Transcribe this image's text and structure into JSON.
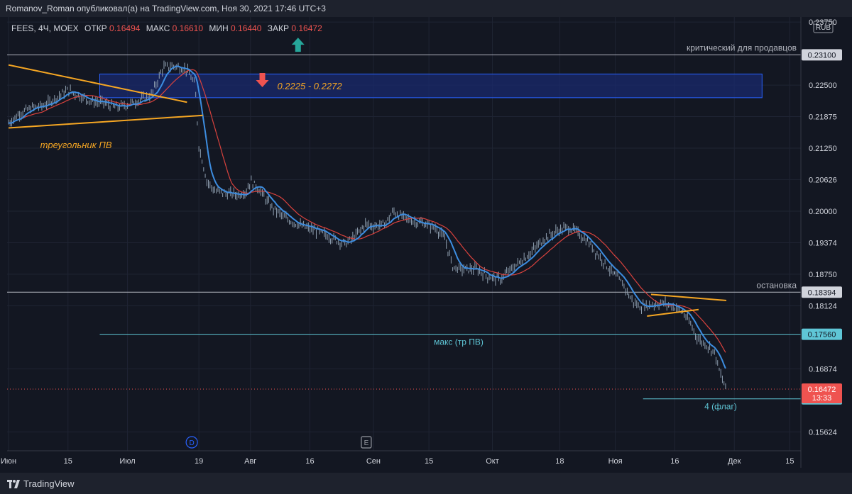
{
  "header": {
    "text": "Romanov_Roman опубликовал(а) на TradingView.com, Ноя 30, 2021 17:46 UTC+3"
  },
  "footer": {
    "brand": "TradingView"
  },
  "colors": {
    "background": "#131722",
    "panel": "#1e222d",
    "grid": "#1f2433",
    "candles": "#8f9fb0",
    "ma_fast": "#3d8de0",
    "ma_slow": "#d9423d",
    "triangle": "#f5a623",
    "zone": "#1a2a6e",
    "zone_border": "#2962ff",
    "resistance_line": "#b2b5be",
    "cyan_line": "#5fc6d6",
    "last_price": "#ef5350",
    "arrow_up": "#26a69a",
    "arrow_down": "#ef5350"
  },
  "chart_data": {
    "type": "candlestick",
    "symbol_line": {
      "symbol": "FEES, 4Ч, MOEX",
      "open_label": "ОТКР",
      "open": "0.16494",
      "high_label": "МАКС",
      "high": "0.16610",
      "low_label": "МИН",
      "low": "0.16440",
      "close_label": "ЗАКР",
      "close": "0.16472"
    },
    "currency": "RUB",
    "ylim": [
      0.1525,
      0.2385
    ],
    "x_days_range": [
      0,
      198
    ],
    "y_ticks": [
      "0.23750",
      "0.22500",
      "0.21875",
      "0.21250",
      "0.20626",
      "0.20000",
      "0.19374",
      "0.18750",
      "0.18124",
      "0.16874",
      "0.15624"
    ],
    "x_ticks": [
      {
        "label": "Июн",
        "day": 0
      },
      {
        "label": "15",
        "day": 15
      },
      {
        "label": "Июл",
        "day": 30
      },
      {
        "label": "19",
        "day": 48
      },
      {
        "label": "Авг",
        "day": 61
      },
      {
        "label": "16",
        "day": 76
      },
      {
        "label": "Сен",
        "day": 92
      },
      {
        "label": "15",
        "day": 106
      },
      {
        "label": "Окт",
        "day": 122
      },
      {
        "label": "18",
        "day": 139
      },
      {
        "label": "Ноя",
        "day": 153
      },
      {
        "label": "16",
        "day": 168
      },
      {
        "label": "Дек",
        "day": 183
      },
      {
        "label": "15",
        "day": 197
      }
    ],
    "price_path": [
      [
        0,
        0.2175
      ],
      [
        3,
        0.2195
      ],
      [
        6,
        0.2205
      ],
      [
        9,
        0.221
      ],
      [
        12,
        0.2225
      ],
      [
        15,
        0.224
      ],
      [
        18,
        0.2228
      ],
      [
        21,
        0.2218
      ],
      [
        24,
        0.2215
      ],
      [
        27,
        0.2205
      ],
      [
        30,
        0.2212
      ],
      [
        33,
        0.222
      ],
      [
        36,
        0.223
      ],
      [
        39,
        0.2285
      ],
      [
        42,
        0.2288
      ],
      [
        45,
        0.228
      ],
      [
        47,
        0.225
      ],
      [
        48,
        0.213
      ],
      [
        50,
        0.206
      ],
      [
        52,
        0.204
      ],
      [
        55,
        0.2035
      ],
      [
        58,
        0.2033
      ],
      [
        60,
        0.204
      ],
      [
        61,
        0.206
      ],
      [
        63,
        0.2045
      ],
      [
        66,
        0.201
      ],
      [
        70,
        0.1985
      ],
      [
        74,
        0.197
      ],
      [
        78,
        0.196
      ],
      [
        82,
        0.1945
      ],
      [
        85,
        0.1935
      ],
      [
        88,
        0.1955
      ],
      [
        90,
        0.1975
      ],
      [
        92,
        0.197
      ],
      [
        95,
        0.1975
      ],
      [
        97,
        0.2
      ],
      [
        99,
        0.199
      ],
      [
        102,
        0.198
      ],
      [
        105,
        0.1975
      ],
      [
        108,
        0.1965
      ],
      [
        110,
        0.1945
      ],
      [
        112,
        0.189
      ],
      [
        114,
        0.1885
      ],
      [
        118,
        0.1885
      ],
      [
        121,
        0.187
      ],
      [
        124,
        0.1865
      ],
      [
        126,
        0.188
      ],
      [
        129,
        0.19
      ],
      [
        132,
        0.192
      ],
      [
        135,
        0.1945
      ],
      [
        138,
        0.196
      ],
      [
        141,
        0.1968
      ],
      [
        143,
        0.196
      ],
      [
        146,
        0.194
      ],
      [
        149,
        0.191
      ],
      [
        152,
        0.188
      ],
      [
        155,
        0.1855
      ],
      [
        157,
        0.1825
      ],
      [
        159,
        0.181
      ],
      [
        162,
        0.1815
      ],
      [
        165,
        0.1818
      ],
      [
        168,
        0.181
      ],
      [
        170,
        0.18
      ],
      [
        172,
        0.1775
      ],
      [
        174,
        0.1745
      ],
      [
        176,
        0.1735
      ],
      [
        178,
        0.172
      ],
      [
        179,
        0.169
      ],
      [
        180,
        0.1665
      ],
      [
        181,
        0.1647
      ]
    ],
    "moving_averages": [
      "fast",
      "slow"
    ],
    "horizontal_levels": [
      {
        "value": 0.231,
        "style": "solid",
        "color": "#b2b5be",
        "from_day": 0,
        "label": "критический для продавцов",
        "axis_label": "0.23100"
      },
      {
        "value": 0.18394,
        "style": "solid",
        "color": "#b2b5be",
        "from_day": 0,
        "label": "остановка",
        "axis_label": "0.18394"
      },
      {
        "value": 0.1756,
        "style": "solid",
        "color": "#5fc6d6",
        "from_day": 23,
        "label": "макс (тр ПВ)",
        "axis_label": "0.17560"
      },
      {
        "value": 0.1628,
        "style": "solid",
        "color": "#5fc6d6",
        "from_day": 160,
        "label": "4 (флаг)",
        "axis_label": "0.16280"
      },
      {
        "value": 0.16472,
        "style": "dotted",
        "color": "#ef5350",
        "from_day": 0,
        "axis_label": "0.16472",
        "countdown": "13:33"
      }
    ],
    "zone": {
      "y_low": 0.2225,
      "y_high": 0.2272,
      "from_day": 23,
      "to_day": 190,
      "label": "0.2225 - 0.2272"
    },
    "triangles": [
      {
        "lines": [
          [
            [
              0,
              0.229
            ],
            [
              45,
              0.2216
            ]
          ],
          [
            [
              0,
              0.2165
            ],
            [
              49,
              0.219
            ]
          ]
        ],
        "label": "треугольник ПВ",
        "label_at": [
          8,
          0.2125
        ]
      },
      {
        "lines": [
          [
            [
              162,
              0.1835
            ],
            [
              181,
              0.1823
            ]
          ],
          [
            [
              161,
              0.1792
            ],
            [
              174,
              0.1805
            ]
          ]
        ]
      }
    ],
    "arrows": [
      {
        "type": "up",
        "day": 73,
        "value": 0.233
      },
      {
        "type": "down",
        "day": 64,
        "value": 0.226
      }
    ],
    "event_markers": [
      {
        "letter": "D",
        "day": 48,
        "color": "#2962ff"
      },
      {
        "letter": "E",
        "day": 92,
        "color": "#9598a1"
      }
    ]
  }
}
